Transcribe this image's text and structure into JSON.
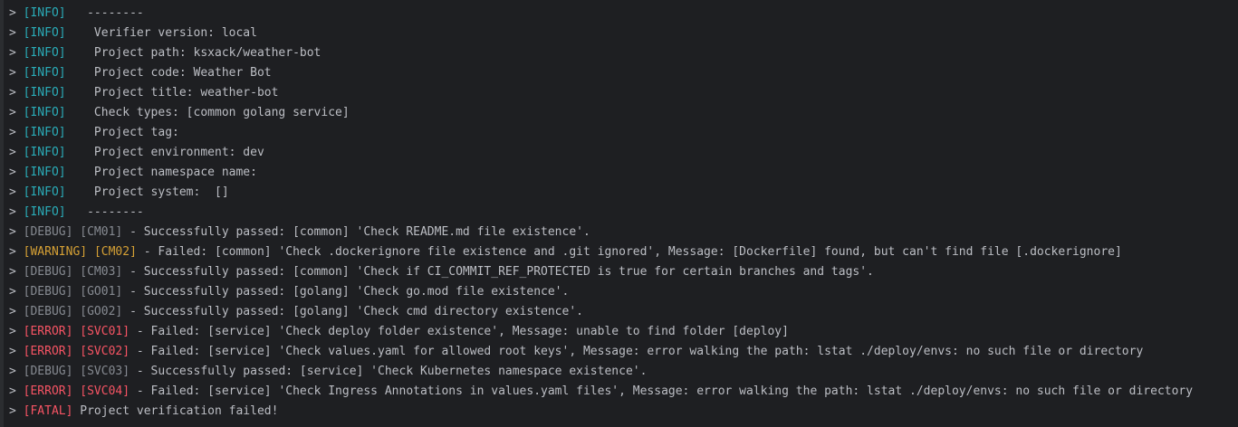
{
  "terminal": {
    "prompt_symbol": ">",
    "lines": [
      {
        "tag": "[INFO]",
        "level": "info",
        "code": "",
        "text": "  --------"
      },
      {
        "tag": "[INFO]",
        "level": "info",
        "code": "",
        "text": "   Verifier version: local"
      },
      {
        "tag": "[INFO]",
        "level": "info",
        "code": "",
        "text": "   Project path: ksxack/weather-bot"
      },
      {
        "tag": "[INFO]",
        "level": "info",
        "code": "",
        "text": "   Project code: Weather Bot"
      },
      {
        "tag": "[INFO]",
        "level": "info",
        "code": "",
        "text": "   Project title: weather-bot"
      },
      {
        "tag": "[INFO]",
        "level": "info",
        "code": "",
        "text": "   Check types: [common golang service]"
      },
      {
        "tag": "[INFO]",
        "level": "info",
        "code": "",
        "text": "   Project tag:"
      },
      {
        "tag": "[INFO]",
        "level": "info",
        "code": "",
        "text": "   Project environment: dev"
      },
      {
        "tag": "[INFO]",
        "level": "info",
        "code": "",
        "text": "   Project namespace name:"
      },
      {
        "tag": "[INFO]",
        "level": "info",
        "code": "",
        "text": "   Project system:  []"
      },
      {
        "tag": "[INFO]",
        "level": "info",
        "code": "",
        "text": "  --------"
      },
      {
        "tag": "[DEBUG]",
        "level": "debug",
        "code": "[CM01]",
        "text": " - Successfully passed: [common] 'Check README.md file existence'."
      },
      {
        "tag": "[WARNING]",
        "level": "warning",
        "code": "[CM02]",
        "text": " - Failed: [common] 'Check .dockerignore file existence and .git ignored', Message: [Dockerfile] found, but can't find file [.dockerignore]"
      },
      {
        "tag": "[DEBUG]",
        "level": "debug",
        "code": "[CM03]",
        "text": " - Successfully passed: [common] 'Check if CI_COMMIT_REF_PROTECTED is true for certain branches and tags'."
      },
      {
        "tag": "[DEBUG]",
        "level": "debug",
        "code": "[GO01]",
        "text": " - Successfully passed: [golang] 'Check go.mod file existence'."
      },
      {
        "tag": "[DEBUG]",
        "level": "debug",
        "code": "[GO02]",
        "text": " - Successfully passed: [golang] 'Check cmd directory existence'."
      },
      {
        "tag": "[ERROR]",
        "level": "error",
        "code": "[SVC01]",
        "text": " - Failed: [service] 'Check deploy folder existence', Message: unable to find folder [deploy]"
      },
      {
        "tag": "[ERROR]",
        "level": "error",
        "code": "[SVC02]",
        "text": " - Failed: [service] 'Check values.yaml for allowed root keys', Message: error walking the path: lstat ./deploy/envs: no such file or directory"
      },
      {
        "tag": "[DEBUG]",
        "level": "debug",
        "code": "[SVC03]",
        "text": " - Successfully passed: [service] 'Check Kubernetes namespace existence'."
      },
      {
        "tag": "[ERROR]",
        "level": "error",
        "code": "[SVC04]",
        "text": " - Failed: [service] 'Check Ingress Annotations in values.yaml files', Message: error walking the path: lstat ./deploy/envs: no such file or directory"
      },
      {
        "tag": "[FATAL]",
        "level": "fatal",
        "code": "",
        "text": " Project verification failed!"
      }
    ]
  },
  "colors": {
    "background": "#1e1f22",
    "info": "#2aacb8",
    "debug": "#868a91",
    "warning": "#d5a035",
    "error": "#f75464",
    "text": "#bcbec4"
  }
}
